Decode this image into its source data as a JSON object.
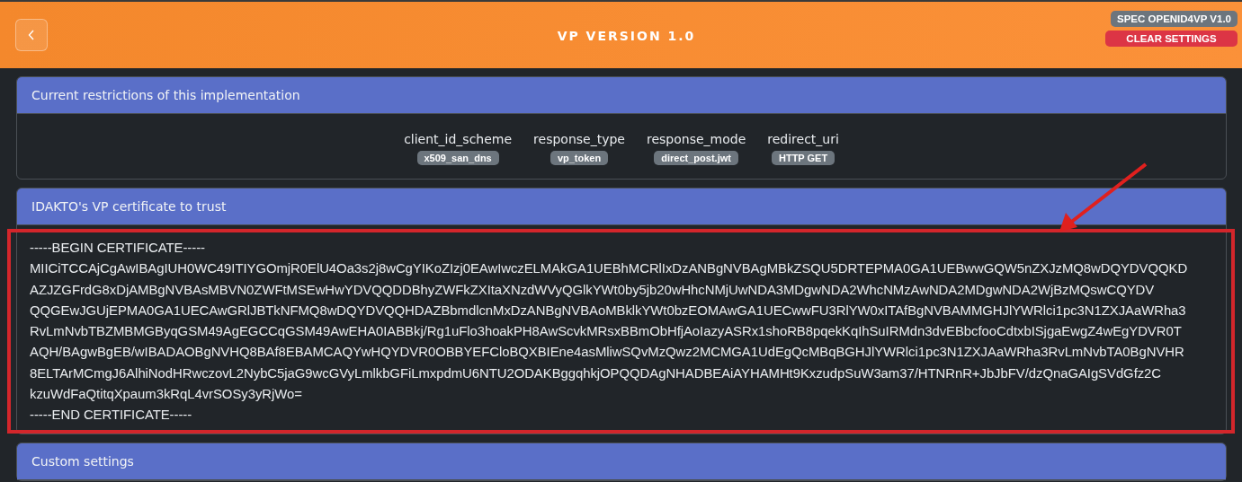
{
  "header": {
    "back_button": {
      "kind": "back"
    },
    "title": "VP VERSION 1.0",
    "badges": [
      {
        "label": "SPEC OPENID4VP V1.0",
        "kind": "info"
      },
      {
        "label": "CLEAR SETTINGS",
        "kind": "danger"
      }
    ]
  },
  "cards": [
    {
      "title": "Current restrictions of this implementation",
      "kind": "restrictions",
      "restrictions": [
        {
          "name": "client_id_scheme",
          "value": "x509_san_dns"
        },
        {
          "name": "response_type",
          "value": "vp_token"
        },
        {
          "name": "response_mode",
          "value": "direct_post.jwt"
        },
        {
          "name": "redirect_uri",
          "value": "HTTP GET"
        }
      ]
    },
    {
      "title": "IDAKTO's VP certificate to trust",
      "kind": "certificate",
      "highlighted": true,
      "lines": [
        "-----BEGIN CERTIFICATE-----",
        "MIICiTCCAjCgAwIBAgIUH0WC49ITIYGOmjR0ElU4Oa3s2j8wCgYIKoZIzj0EAwIwczELMAkGA1UEBhMCRlIxDzANBgNVBAgMBkZSQU5DRTEPMA0GA1UEBwwGQW5nZXJzMQ8wDQYDVQQKD",
        "AZJZGFrdG8xDjAMBgNVBAsMBVN0ZWFtMSEwHwYDVQQDDBhyZWFkZXItaXNzdWVyQGlkYWt0by5jb20wHhcNMjUwNDA3MDgwNDA2WhcNMzAwNDA2MDgwNDA2WjBzMQswCQYDV",
        "QQGEwJGUjEPMA0GA1UECAwGRlJBTkNFMQ8wDQYDVQQHDAZBbmdlcnMxDzANBgNVBAoMBklkYWt0bzEOMAwGA1UECwwFU3RlYW0xITAfBgNVBAMMGHJlYWRlci1pc3N1ZXJAaWRha3",
        "RvLmNvbTBZMBMGByqGSM49AgEGCCqGSM49AwEHA0IABBkj/Rg1uFlo3hoakPH8AwScvkMRsxBBmObHfjAoIazyASRx1shoRB8pqekKqIhSuIRMdn3dvEBbcfooCdtxbISjgaEwgZ4wEgYDVR0T",
        "AQH/BAgwBgEB/wIBADAOBgNVHQ8BAf8EBAMCAQYwHQYDVR0OBBYEFCloBQXBIEne4asMliwSQvMzQwz2MCMGA1UdEgQcMBqBGHJlYWRlci1pc3N1ZXJAaWRha3RvLmNvbTA0BgNVHR",
        "8ELTArMCmgJ6AlhiNodHRwczovL2NybC5jaG9wcGVyLmlkbGFiLmxpdmU6NTU2ODAKBggqhkjOPQQDAgNHADBEAiAYHAMHt9KxzudpSuW3am37/HTNRnR+JbJbFV/dzQnaGAIgSVdGfz2C",
        "kzuWdFaQtitqXpaum3kRqL4vrSOSy3yRjWo=",
        "-----END CERTIFICATE-----"
      ]
    },
    {
      "title": "Custom settings",
      "kind": "collapsed"
    }
  ],
  "annotations": [
    {
      "kind": "arrow"
    }
  ]
}
